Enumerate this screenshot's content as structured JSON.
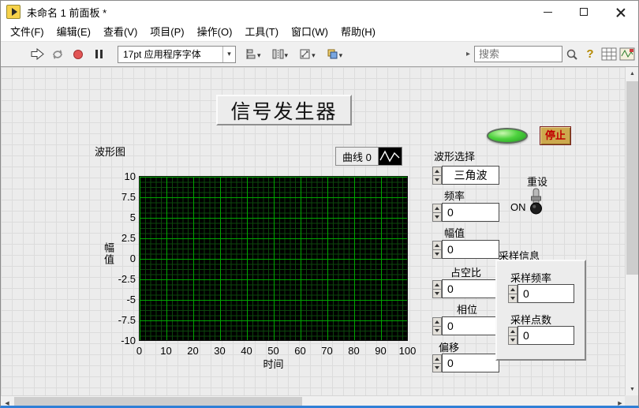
{
  "window": {
    "title": "未命名 1 前面板 *"
  },
  "menu": {
    "items": [
      "文件(F)",
      "编辑(E)",
      "查看(V)",
      "项目(P)",
      "操作(O)",
      "工具(T)",
      "窗口(W)",
      "帮助(H)"
    ]
  },
  "toolbar": {
    "font_selector": "17pt 应用程序字体",
    "search_placeholder": "搜索"
  },
  "panel": {
    "title": "信号发生器",
    "chart": {
      "label": "波形图",
      "legend": "曲线 0",
      "y_label": "幅值",
      "x_label": "时间",
      "y_ticks": [
        "10",
        "7.5",
        "5",
        "2.5",
        "0",
        "-2.5",
        "-5",
        "-7.5",
        "-10"
      ],
      "x_ticks": [
        "0",
        "10",
        "20",
        "30",
        "40",
        "50",
        "60",
        "70",
        "80",
        "90",
        "100"
      ]
    },
    "controls": {
      "waveform": {
        "label": "波形选择",
        "value": "三角波"
      },
      "frequency": {
        "label": "频率",
        "value": "0"
      },
      "amplitude": {
        "label": "幅值",
        "value": "0"
      },
      "duty": {
        "label": "占空比",
        "value": "0"
      },
      "phase": {
        "label": "相位",
        "value": "0"
      },
      "offset": {
        "label": "偏移",
        "value": "0"
      },
      "reset": {
        "label": "重设",
        "state": "ON"
      },
      "stop": {
        "label": "停止"
      }
    },
    "sampling": {
      "label": "采样信息",
      "sample_rate": {
        "label": "采样频率",
        "value": "0"
      },
      "sample_count": {
        "label": "采样点数",
        "value": "0"
      }
    }
  },
  "colors": {
    "plot_bg": "#000000",
    "grid_major": "#00a800",
    "grid_minor": "#0d470d",
    "led_green": "#35c02c",
    "stop_face": "#cda94e",
    "stop_text": "#c00000"
  }
}
